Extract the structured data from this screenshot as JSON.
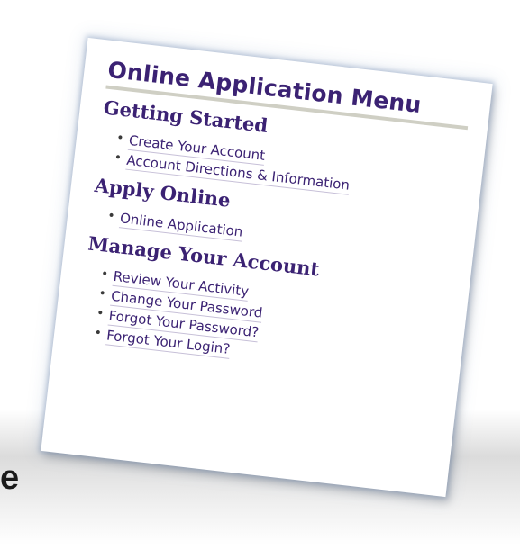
{
  "background": {
    "partial_letter": "e"
  },
  "menu": {
    "title": "Online Application Menu",
    "sections": [
      {
        "heading": "Getting Started",
        "links": [
          "Create Your Account",
          "Account Directions & Information"
        ]
      },
      {
        "heading": "Apply Online",
        "links": [
          "Online Application"
        ]
      },
      {
        "heading": "Manage Your Account",
        "links": [
          "Review Your Activity",
          "Change Your Password",
          "Forgot Your Password?",
          "Forgot Your Login?"
        ]
      }
    ]
  },
  "colors": {
    "heading": "#3b2273",
    "divider": "#cfcfc4"
  }
}
